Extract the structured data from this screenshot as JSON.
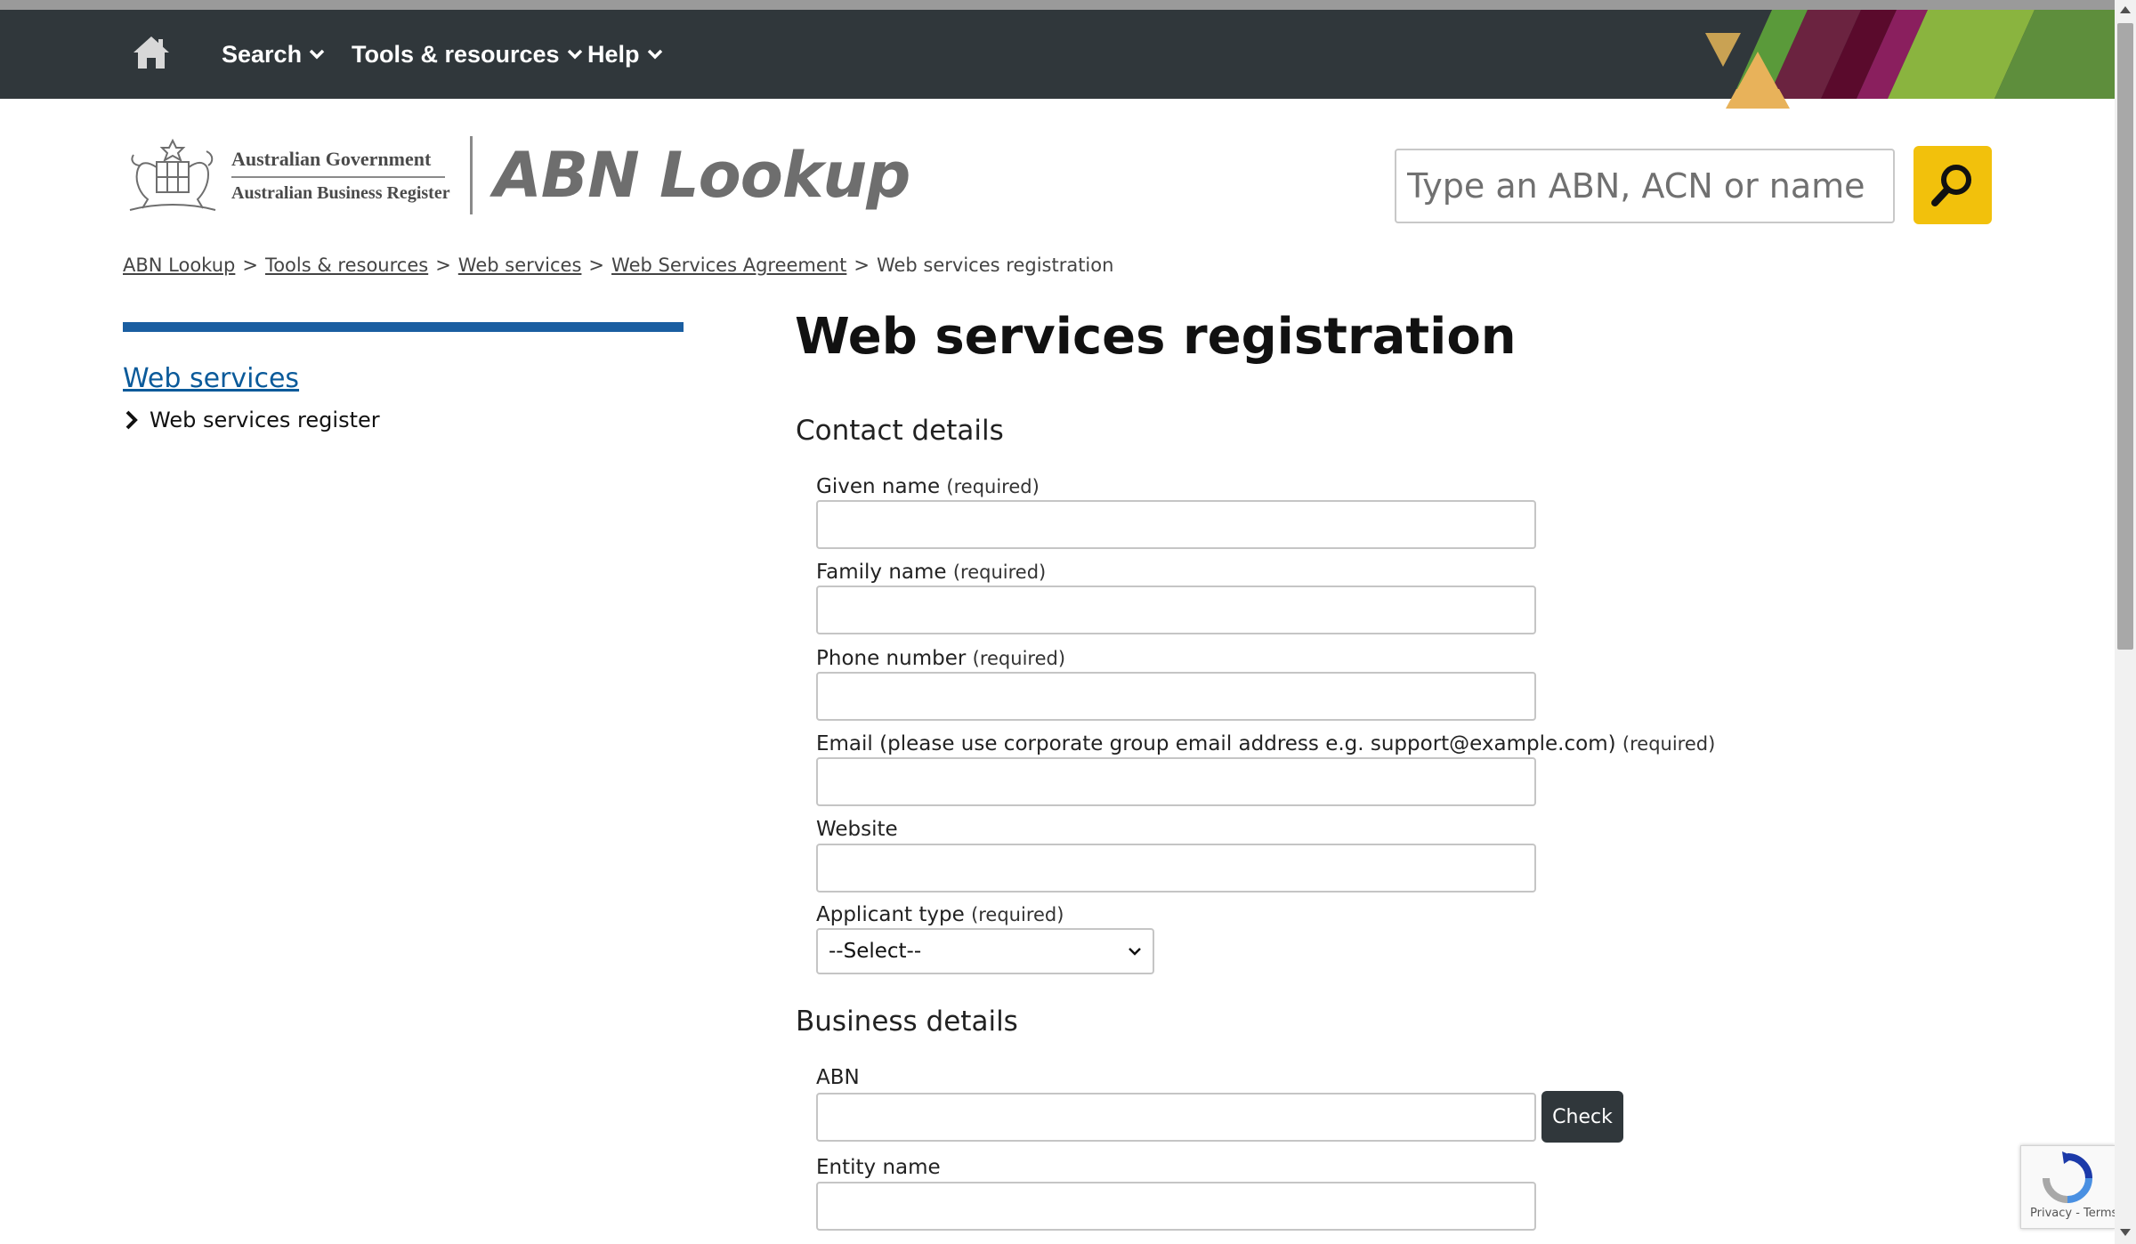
{
  "nav": {
    "items": [
      {
        "label": "Search"
      },
      {
        "label": "Tools & resources"
      },
      {
        "label": "Help"
      }
    ]
  },
  "header": {
    "gov_line1": "Australian Government",
    "gov_line2": "Australian Business Register",
    "site_title": "ABN Lookup",
    "search_placeholder": "Type an ABN, ACN or name"
  },
  "breadcrumb": {
    "items": [
      "ABN Lookup",
      "Tools & resources",
      "Web services",
      "Web Services Agreement"
    ],
    "current": "Web services registration",
    "separator": ">"
  },
  "sidebar": {
    "title": "Web services",
    "sub_item": "Web services register"
  },
  "main": {
    "title": "Web services registration",
    "contact_heading": "Contact details",
    "business_heading": "Business details",
    "required_tag": "(required)",
    "fields": {
      "given_name": "Given name",
      "family_name": "Family name",
      "phone": "Phone number",
      "email": "Email (please use corporate group email address e.g. support@example.com)",
      "website": "Website",
      "applicant_type": "Applicant type",
      "abn": "ABN",
      "entity_name": "Entity name"
    },
    "applicant_type_value": "--Select--",
    "check_label": "Check"
  },
  "recaptcha": {
    "links": "Privacy - Terms"
  },
  "colors": {
    "nav_bg": "#30373b",
    "search_button": "#f2c10c",
    "sidebar_rule": "#1a5ea1",
    "link": "#0a5a9a"
  }
}
